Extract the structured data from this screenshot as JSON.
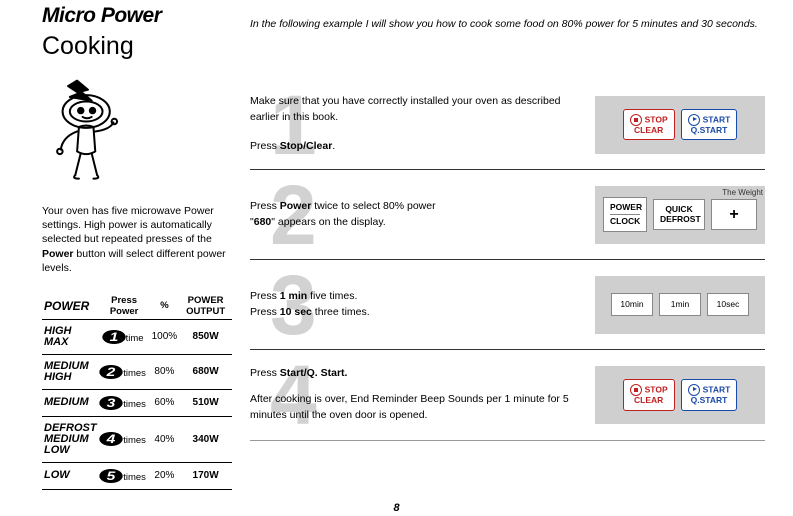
{
  "header": {
    "title_main": "Micro Power",
    "title_sub": "Cooking",
    "intro": "In the following example I will show you how to cook some food on 80% power for 5 minutes and 30 seconds."
  },
  "sidebar": {
    "note_pre": "Your oven has five microwave Power settings. High power is automatically selected but repeated presses of the ",
    "note_bold": "Power",
    "note_post": " button will select different power levels."
  },
  "table": {
    "headers": {
      "power": "POWER",
      "press": "Press Power",
      "pct": "%",
      "output": "POWER OUTPUT"
    },
    "rows": [
      {
        "label": "HIGH MAX",
        "num": "1",
        "times": "time",
        "pct": "100%",
        "output": "850W"
      },
      {
        "label": "MEDIUM HIGH",
        "num": "2",
        "times": "times",
        "pct": "80%",
        "output": "680W"
      },
      {
        "label": "MEDIUM",
        "num": "3",
        "times": "times",
        "pct": "60%",
        "output": "510W"
      },
      {
        "label": "DEFROST MEDIUM LOW",
        "num": "4",
        "times": "times",
        "pct": "40%",
        "output": "340W"
      },
      {
        "label": "LOW",
        "num": "5",
        "times": "times",
        "pct": "20%",
        "output": "170W"
      }
    ]
  },
  "steps": {
    "step1": {
      "num": "1",
      "text_a": "Make sure that you have correctly installed your oven as described earlier in this book.",
      "text_b_pre": "Press ",
      "text_b_bold": "Stop/Clear",
      "text_b_post": "."
    },
    "step2": {
      "num": "2",
      "text_a_pre": "Press ",
      "text_a_bold": "Power",
      "text_a_post": " twice to select 80% power",
      "text_b_pre": "\"",
      "text_b_bold": "680",
      "text_b_post": "\" appears on the display.",
      "panel_label": "The Weight"
    },
    "step3": {
      "num": "3",
      "text_a_pre": "Press ",
      "text_a_bold": "1 min",
      "text_a_post": " five times.",
      "text_b_pre": "Press ",
      "text_b_bold": "10 sec",
      "text_b_post": " three times."
    },
    "step4": {
      "num": "4",
      "text_a_pre": "Press ",
      "text_a_bold": "Start/Q. Start.",
      "text_b": "After cooking is over, End Reminder Beep Sounds per 1 minute for 5 minutes until the oven door is opened."
    }
  },
  "buttons": {
    "stop_l1": "STOP",
    "stop_l2": "CLEAR",
    "start_l1": "START",
    "start_l2": "Q.START",
    "power_l1": "POWER",
    "power_l2": "CLOCK",
    "defrost_l1": "QUICK",
    "defrost_l2": "DEFROST",
    "plus": "+",
    "t10min": "10min",
    "t1min": "1min",
    "t10sec": "10sec"
  },
  "page_number": "8"
}
